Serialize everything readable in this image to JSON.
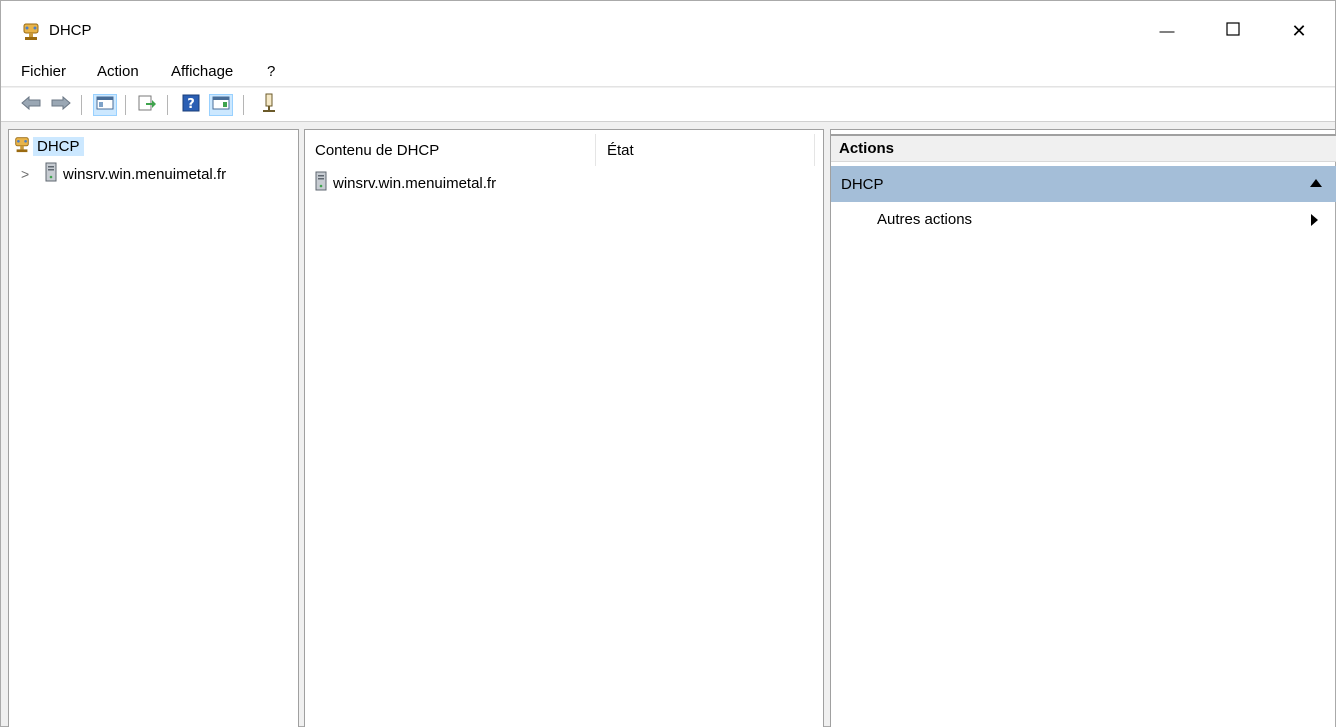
{
  "window": {
    "title": "DHCP",
    "minimize_glyph": "—",
    "close_glyph": "✕"
  },
  "menu": {
    "file": "Fichier",
    "action": "Action",
    "view": "Affichage",
    "help": "?"
  },
  "toolbar": {
    "buttons": [
      "back-arrow-icon",
      "forward-arrow-icon",
      "show-tree-icon",
      "export-list-icon",
      "help-icon",
      "show-action-pane-icon",
      "dhcp-server-icon"
    ]
  },
  "tree": {
    "root_label": "DHCP",
    "child_label": "winsrv.win.menuimetal.fr",
    "expander_glyph": ">"
  },
  "list": {
    "columns": [
      "Contenu de DHCP",
      "État"
    ],
    "rows": [
      {
        "name": "winsrv.win.menuimetal.fr",
        "status": ""
      }
    ]
  },
  "actions": {
    "header": "Actions",
    "group_title": "DHCP",
    "items": [
      "Autres actions"
    ]
  },
  "colors": {
    "selection": "#cce8ff",
    "action_group": "#a4bed8"
  }
}
